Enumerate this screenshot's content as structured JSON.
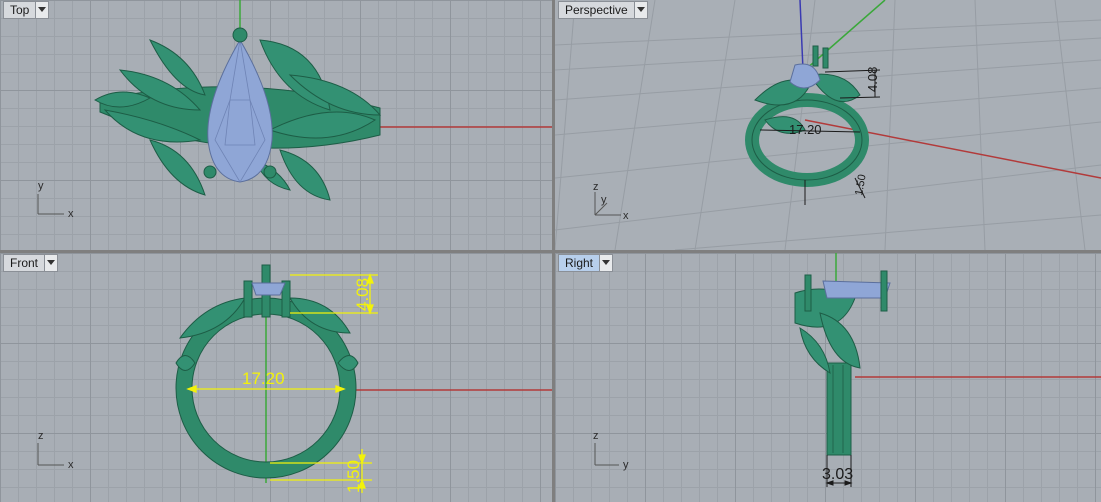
{
  "viewports": {
    "top": {
      "label": "Top",
      "axes": {
        "a": "y",
        "b": "x"
      }
    },
    "perspective": {
      "label": "Perspective",
      "axes": {
        "a": "z",
        "b": "y",
        "c": "x"
      },
      "dims": {
        "height": "4.08",
        "diameter": "17.20",
        "band": "1.50"
      }
    },
    "front": {
      "label": "Front",
      "axes": {
        "a": "z",
        "b": "x"
      },
      "dims": {
        "height": "4.08",
        "diameter": "17.20",
        "band": "1.50"
      }
    },
    "right": {
      "label": "Right",
      "axes": {
        "a": "z",
        "b": "y"
      },
      "dims": {
        "width": "3.03"
      }
    }
  },
  "colors": {
    "viewport_bg": "#a8aeb5",
    "grid_major": "#8f959c",
    "model_green": "#2f8a6a",
    "gem_blue": "#8fa6d6",
    "dimension_yellow": "#f2f20a",
    "axis_red": "#b23a3a",
    "axis_green": "#3aa83a",
    "axis_blue": "#3a3ab2"
  }
}
